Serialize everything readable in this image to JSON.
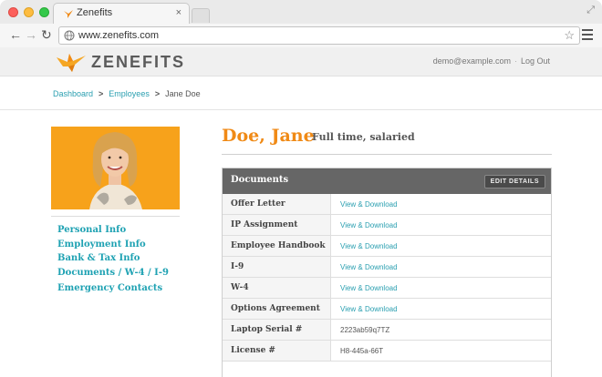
{
  "browser": {
    "tab_title": "Zenefits",
    "tab_close": "×",
    "url": "www.zenefits.com",
    "back_glyph": "←",
    "forward_glyph": "→",
    "reload_glyph": "↻",
    "star_glyph": "☆",
    "resize_glyph": "⤢"
  },
  "header": {
    "logo_text": "ZENEFITS",
    "user_email": "demo@example.com",
    "separator": "·",
    "logout": "Log Out"
  },
  "breadcrumb": {
    "items": [
      "Dashboard",
      "Employees",
      "Jane Doe"
    ],
    "separator": ">"
  },
  "sidebar": {
    "links": [
      "Personal Info",
      "Employment Info",
      "Bank & Tax Info",
      "Documents / W-4 / I-9",
      "Emergency Contacts"
    ]
  },
  "employee": {
    "name": "Doe, Jane",
    "type": "Full time, salaried"
  },
  "documents": {
    "title": "Documents",
    "edit_label": "EDIT DETAILS",
    "rows": [
      {
        "label": "Offer Letter",
        "value": "View & Download"
      },
      {
        "label": "IP Assignment",
        "value": "View & Download"
      },
      {
        "label": "Employee Handbook",
        "value": "View & Download"
      },
      {
        "label": "I-9",
        "value": "View & Download"
      },
      {
        "label": "W-4",
        "value": "View & Download"
      },
      {
        "label": "Options Agreement",
        "value": "View & Download"
      },
      {
        "label": "Laptop Serial #",
        "value": "2223ab59q7TZ"
      },
      {
        "label": "License #",
        "value": "H8-445a-66T"
      }
    ]
  },
  "colors": {
    "accent_orange": "#f08a16",
    "link_teal": "#1fa2b3",
    "panel_header": "#666666"
  }
}
